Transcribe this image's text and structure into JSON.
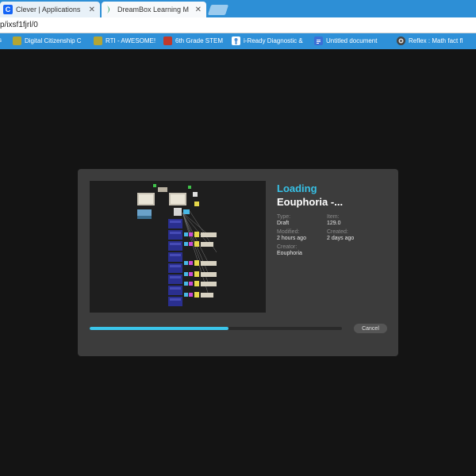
{
  "browser": {
    "tabs": [
      {
        "title": "Clever | Applications",
        "favicon_letter": "C",
        "favicon_color": "#1464f6",
        "active": false
      },
      {
        "title": "DreamBox Learning M",
        "favicon_letter": "",
        "favicon_color": "#2f9e61",
        "active": true
      }
    ],
    "close_glyph": "✕",
    "address": "p/ixsf1fjrl/0",
    "bookmarks": [
      {
        "label": "s",
        "icon": "bookmark-icon",
        "color": "#f5a623",
        "glyph": ""
      },
      {
        "label": "Digital Citizenship C",
        "icon": "classroom-icon",
        "color": "#b3a534",
        "glyph": ""
      },
      {
        "label": "RTI - AWESOME!",
        "icon": "classroom-icon",
        "color": "#b3a534",
        "glyph": ""
      },
      {
        "label": "6th Grade STEM",
        "icon": "stem-icon",
        "color": "#c0392b",
        "glyph": ""
      },
      {
        "label": "i-Ready Diagnostic &",
        "icon": "iready-icon",
        "color": "#4a90d9",
        "glyph": ""
      },
      {
        "label": "Untitled document",
        "icon": "doc-icon",
        "color": "#3b6fd6",
        "glyph": ""
      },
      {
        "label": "Reflex : Math fact fl",
        "icon": "reflex-icon",
        "color": "#444444",
        "glyph": ""
      }
    ]
  },
  "dialog": {
    "status": "Loading",
    "project_name": "Eouphoria -...",
    "meta": {
      "type_label": "Type:",
      "type_value": "Draft",
      "item_label": "Item:",
      "item_value": "129.0",
      "modified_label": "Modified:",
      "modified_value": "2 hours ago",
      "created_label": "Created:",
      "created_value": "2 days ago",
      "creator_label": "Creator:",
      "creator_value": "Eouphoria"
    },
    "progress": 0.55,
    "cancel_label": "Cancel",
    "accent_color": "#37c1e6"
  }
}
